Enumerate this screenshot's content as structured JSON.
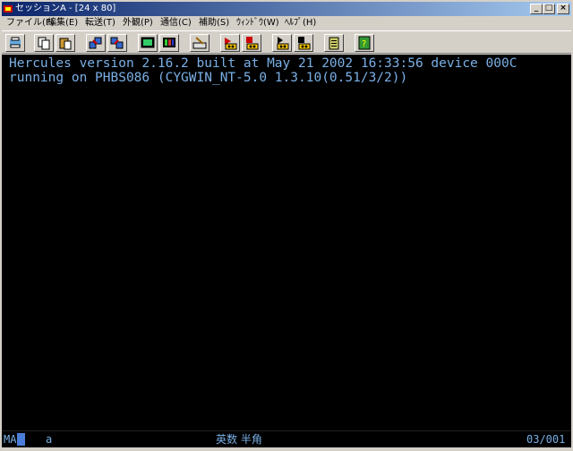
{
  "window": {
    "title": "セッションA - [24 x 80]",
    "minimize": "_",
    "maximize": "□",
    "close": "×"
  },
  "menu": [
    {
      "label": "ファイル(F)"
    },
    {
      "label": "編集(E)"
    },
    {
      "label": "転送(T)"
    },
    {
      "label": "外観(P)"
    },
    {
      "label": "通信(C)"
    },
    {
      "label": "補助(S)"
    },
    {
      "label": "ｳｨﾝﾄﾞｳ(W)"
    },
    {
      "label": "ﾍﾙﾌﾟ(H)"
    }
  ],
  "toolbar": {
    "buttons": [
      {
        "icon": "print-screen-icon"
      },
      {
        "icon": "copy-icon"
      },
      {
        "icon": "paste-icon"
      },
      {
        "icon": "send-file-icon"
      },
      {
        "icon": "receive-file-icon"
      },
      {
        "icon": "display-setup-icon"
      },
      {
        "icon": "color-setup-icon"
      },
      {
        "icon": "keyboard-map-icon"
      },
      {
        "icon": "macro-record-icon"
      },
      {
        "icon": "macro-stop-icon"
      },
      {
        "icon": "macro-play-icon"
      },
      {
        "icon": "macro-pause-icon"
      },
      {
        "icon": "clipboard-icon"
      },
      {
        "icon": "help-icon"
      }
    ]
  },
  "terminal": {
    "lines": [
      "Hercules version 2.16.2 built at May 21 2002 16:33:56 device 000C",
      "running on PHBS086 (CYGWIN_NT-5.0 1.3.10(0.51/3/2))"
    ]
  },
  "status": {
    "mode": "MA",
    "indicator": "a",
    "input_mode": "英数 半角",
    "position": "03/001"
  },
  "colors": {
    "title_start": "#0a246a",
    "title_end": "#a6caf0",
    "terminal_bg": "#000000",
    "terminal_fg": "#7ab0e6"
  }
}
